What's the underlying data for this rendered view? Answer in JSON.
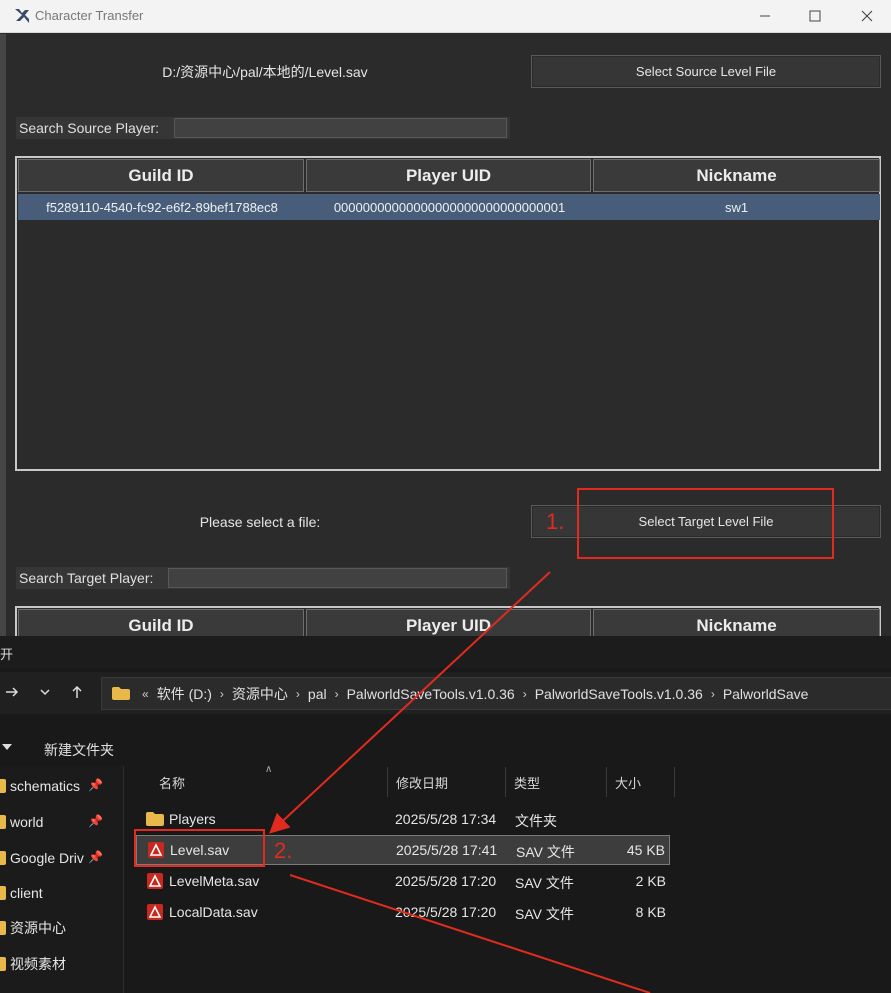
{
  "char_transfer": {
    "window_title": "Character Transfer",
    "source_path": "D:/资源中心/pal/本地的/Level.sav",
    "select_source_button": "Select Source Level File",
    "search_source_label": "Search Source Player:",
    "search_source_value": "",
    "columns": [
      "Guild ID",
      "Player UID",
      "Nickname"
    ],
    "source_rows": [
      {
        "guild_id": "f5289110-4540-fc92-e6f2-89bef1788ec8",
        "player_uid": "00000000000000000000000000000001",
        "nickname": "sw1"
      }
    ],
    "target_message": "Please select a file:",
    "select_target_button": "Select Target Level File",
    "search_target_label": "Search Target Player:",
    "search_target_value": ""
  },
  "explorer": {
    "title_fragment": "开",
    "breadcrumb": [
      "软件 (D:)",
      "资源中心",
      "pal",
      "PalworldSaveTools.v1.0.36",
      "PalworldSaveTools.v1.0.36",
      "PalworldSave"
    ],
    "breadcrumb_prefix": "«",
    "new_folder": "新建文件夹",
    "sidebar": [
      {
        "label": "schematics",
        "pinned": true
      },
      {
        "label": "world",
        "pinned": true
      },
      {
        "label": "Google Driv",
        "pinned": true
      },
      {
        "label": "client",
        "pinned": false
      },
      {
        "label": "资源中心",
        "pinned": false
      },
      {
        "label": "视频素材",
        "pinned": false
      }
    ],
    "pin_glyph": "📌",
    "columns": {
      "name": "名称",
      "date": "修改日期",
      "type": "类型",
      "size": "大小"
    },
    "files": [
      {
        "name": "Players",
        "date": "2025/5/28 17:34",
        "type": "文件夹",
        "size": "",
        "kind": "folder"
      },
      {
        "name": "Level.sav",
        "date": "2025/5/28 17:41",
        "type": "SAV 文件",
        "size": "45 KB",
        "kind": "sav",
        "selected": true
      },
      {
        "name": "LevelMeta.sav",
        "date": "2025/5/28 17:20",
        "type": "SAV 文件",
        "size": "2 KB",
        "kind": "sav"
      },
      {
        "name": "LocalData.sav",
        "date": "2025/5/28 17:20",
        "type": "SAV 文件",
        "size": "8 KB",
        "kind": "sav"
      }
    ]
  },
  "annotations": {
    "step1": "1.",
    "step2": "2.",
    "color": "#e12b1f"
  }
}
